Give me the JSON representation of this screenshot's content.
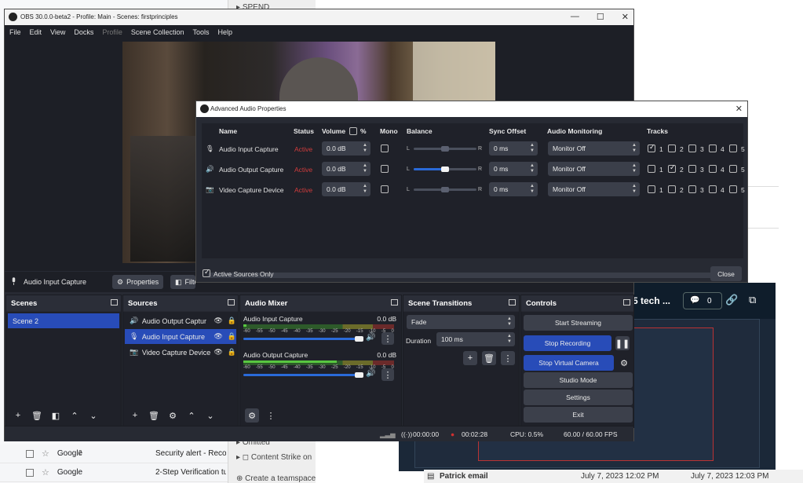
{
  "background": {
    "mail_rows": [
      {
        "from": "",
        "subject": ""
      },
      {
        "from": "Google",
        "count": "2",
        "subject": "Security alert - Recov."
      },
      {
        "from": "Google",
        "subject": "2-Step Verification tur"
      }
    ],
    "mid_items": [
      "SPEND",
      "Omitted",
      "Content Strike on",
      "Create a teamspace"
    ],
    "video_title": "5 tech ...",
    "video_comments": "0",
    "bottom_row": {
      "item": "Patrick email",
      "date1": "July 7, 2023 12:02 PM",
      "date2": "July 7, 2023 12:03 PM"
    }
  },
  "obs": {
    "title": "OBS 30.0.0-beta2 - Profile: Main - Scenes: firstprinciples",
    "menu": [
      "File",
      "Edit",
      "View",
      "Docks",
      "Profile",
      "Scene Collection",
      "Tools",
      "Help"
    ],
    "source_bar": {
      "selected": "Audio Input Capture",
      "properties": "Properties",
      "filters": "Filte"
    },
    "scenes": {
      "title": "Scenes",
      "items": [
        "Scene 2"
      ]
    },
    "sources": {
      "title": "Sources",
      "items": [
        "Audio Output Captur",
        "Audio Input Capture",
        "Video Capture Device"
      ]
    },
    "mixer": {
      "title": "Audio Mixer",
      "channels": [
        {
          "name": "Audio Input Capture",
          "db": "0.0 dB",
          "level": 0.02,
          "volume": 1.0
        },
        {
          "name": "Audio Output Capture",
          "db": "0.0 dB",
          "level": 0.62,
          "volume": 1.0
        }
      ],
      "ticks": [
        "-60",
        "-55",
        "-50",
        "-45",
        "-40",
        "-35",
        "-30",
        "-25",
        "-20",
        "-15",
        "-10",
        "-5",
        "0"
      ]
    },
    "transitions": {
      "title": "Scene Transitions",
      "type": "Fade",
      "duration_label": "Duration",
      "duration": "100 ms"
    },
    "controls": {
      "title": "Controls",
      "start_streaming": "Start Streaming",
      "stop_recording": "Stop Recording",
      "stop_virtual_camera": "Stop Virtual Camera",
      "studio_mode": "Studio Mode",
      "settings": "Settings",
      "exit": "Exit"
    },
    "status": {
      "stream_time": "00:00:00",
      "rec_time": "00:02:28",
      "cpu": "CPU: 0.5%",
      "fps": "60.00 / 60.00 FPS"
    }
  },
  "aap": {
    "title": "Advanced Audio Properties",
    "headers": {
      "name": "Name",
      "status": "Status",
      "volume": "Volume",
      "pct": "%",
      "mono": "Mono",
      "balance": "Balance",
      "sync": "Sync Offset",
      "monitoring": "Audio Monitoring",
      "tracks": "Tracks"
    },
    "rows": [
      {
        "icon": "mic-icon",
        "name": "Audio Input Capture",
        "status": "Active",
        "volume": "0.0 dB",
        "mono": false,
        "balance": 0.5,
        "balance_active": false,
        "sync": "0 ms",
        "monitoring": "Monitor Off",
        "tracks": [
          true,
          false,
          false,
          false,
          false
        ]
      },
      {
        "icon": "speaker-icon",
        "name": "Audio Output Capture",
        "status": "Active",
        "volume": "0.0 dB",
        "mono": false,
        "balance": 0.5,
        "balance_active": true,
        "sync": "0 ms",
        "monitoring": "Monitor Off",
        "tracks": [
          false,
          true,
          false,
          false,
          false
        ]
      },
      {
        "icon": "camera-icon",
        "name": "Video Capture Device",
        "status": "Active",
        "volume": "0.0 dB",
        "mono": false,
        "balance": 0.5,
        "balance_active": false,
        "sync": "0 ms",
        "monitoring": "Monitor Off",
        "tracks": [
          false,
          false,
          false,
          false,
          false
        ]
      }
    ],
    "track_numbers": [
      "1",
      "2",
      "3",
      "4",
      "5"
    ],
    "active_only_label": "Active Sources Only",
    "active_only": true,
    "close": "Close",
    "L": "L",
    "R": "R"
  },
  "colors": {
    "accent": "#284cb8",
    "active_status": "#d03c3c",
    "meter_green": "#58c640"
  }
}
